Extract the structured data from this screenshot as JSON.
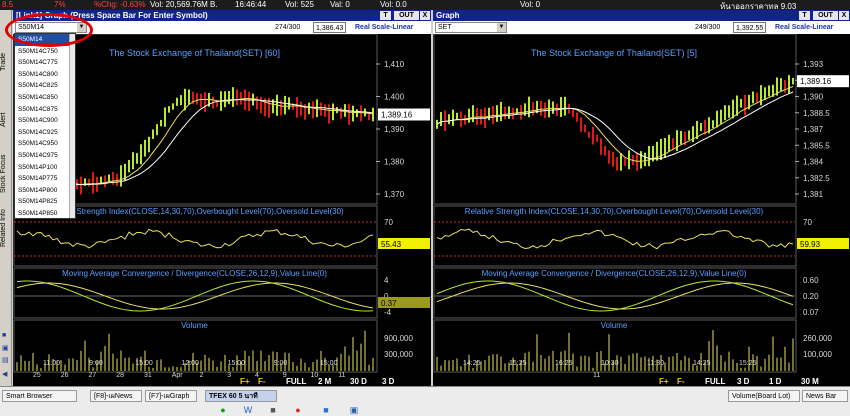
{
  "top_strip": {
    "items": [
      "8.5",
      "7%",
      "%Chg: -0.63%",
      "Vol: 20,569.76M B.",
      "16:46:44",
      "Vol: 525",
      "Val: 0",
      "Vol: 0.0",
      "Vol: 0",
      "ห้นาออกราคาทล 9.03"
    ]
  },
  "left_tabs": [
    "Trade",
    "Alert",
    "Stock Focus",
    "Related Info"
  ],
  "left_pane": {
    "title": "[Link1] Graph (Press Space Bar For Enter Symbol)",
    "symbol": "S50M14",
    "count": "274/300",
    "value": "1,386.43",
    "scale_label": "Real Scale-Linear",
    "btn_t": "T",
    "btn_out": "OUT",
    "btn_x": "X",
    "main_title": "The Stock Exchange of Thailand(SET) [60]",
    "price_ticks": [
      "1,410",
      "1,400",
      "1,390",
      "1,380",
      "1,370"
    ],
    "last_price": "1,389.16",
    "rsi_title": "Relative Strength Index(CLOSE,14,30,70),Overbought Level(70),Oversold Level(30)",
    "rsi_ticks": [
      "70",
      "40"
    ],
    "rsi_value": "55.43",
    "macd_title": "Moving Average Convergence / Divergence(CLOSE,26,12,9),Value Line(0)",
    "macd_ticks": [
      "4",
      "0",
      "-4"
    ],
    "macd_value": "0.37",
    "vol_title": "Volume",
    "vol_ticks": [
      "900,000",
      "300,000"
    ],
    "times": [
      "11:00",
      "9:00",
      "15:00",
      "12:00",
      "15:00",
      "9:00",
      "15:00"
    ],
    "dates": [
      "25",
      "26",
      "27",
      "28",
      "31",
      "Apr",
      "2",
      "3",
      "4",
      "9",
      "10",
      "11"
    ],
    "periods": [
      "FULL",
      "2 M",
      "30 D",
      "3 D"
    ],
    "zoom_in": "F+",
    "zoom_out": "F-"
  },
  "right_pane": {
    "title": "Graph",
    "symbol": "SET",
    "count": "249/300",
    "value": "1,392.55",
    "scale_label": "Real Scale-Linear",
    "btn_t": "T",
    "btn_out": "OUT",
    "btn_x": "X",
    "main_title": "The Stock Exchange of Thailand(SET) [5]",
    "price_ticks": [
      "1,393",
      "1,391.5",
      "1,390",
      "1,388.5",
      "1,387",
      "1,385.5",
      "1,384",
      "1,382.5",
      "1,381"
    ],
    "last_price": "1,389.16",
    "rsi_title": "Relative Strength Index(CLOSE,14,30,70),Overbought Level(70),Oversold Level(30)",
    "rsi_ticks": [
      "70",
      "40"
    ],
    "rsi_value": "59.93",
    "macd_title": "Moving Average Convergence / Divergence(CLOSE,26,12,9),Value Line(0)",
    "macd_ticks": [
      "0.60",
      "0.20",
      "0.07"
    ],
    "vol_title": "Volume",
    "vol_ticks": [
      "260,000",
      "100,000"
    ],
    "times": [
      "14:25",
      "15:25",
      "16:25",
      "10:30",
      "11:30",
      "14:25",
      "15:25"
    ],
    "dates": [
      "11"
    ],
    "periods": [
      "FULL",
      "3 D",
      "1 D",
      "30 M"
    ],
    "zoom_in": "F+",
    "zoom_out": "F-"
  },
  "dropdown": {
    "items": [
      "S50M14",
      "S50M14C750",
      "S50M14C775",
      "S50M14C800",
      "S50M14C825",
      "S50M14C850",
      "S50M14C875",
      "S50M14C900",
      "S50M14C925",
      "S50M14C950",
      "S50M14C975",
      "S50M14P100",
      "S50M14P775",
      "S50M14P800",
      "S50M14P825",
      "S50M14P850"
    ],
    "selected": 0
  },
  "taskbar": {
    "smart_browser": "Smart Browser",
    "tasks": [
      "[F8]-เผNews",
      "[F7]-เผGraph",
      "TFEX 60 5 นาที",
      "Volume(Board Lot)",
      "News Bar"
    ],
    "active_task": "TFEX 60 5 นาที"
  },
  "colors": {
    "title_bar": "#10248c",
    "up_candle": "#b8e830",
    "down_candle": "#e01818",
    "annotation": "#e00000"
  }
}
